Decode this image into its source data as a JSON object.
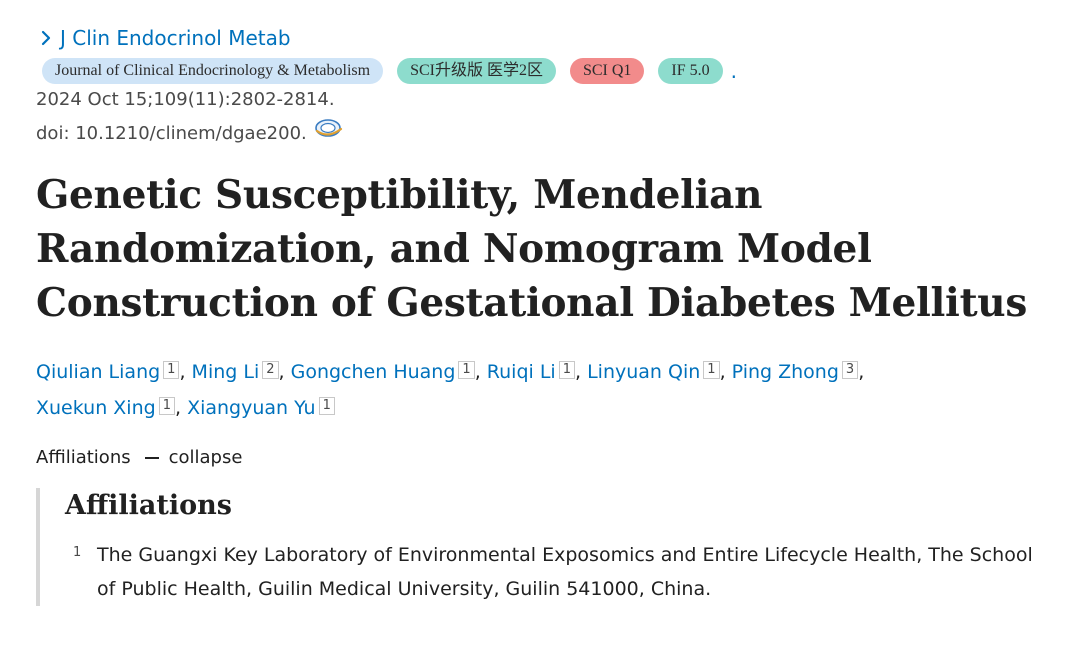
{
  "journal": {
    "abbrev": "J Clin Endocrinol Metab",
    "badges": {
      "full_name": "Journal of Clinical Endocrinology & Metabolism",
      "sci_tier": "SCI升级版 医学2区",
      "sci_q": "SCI Q1",
      "impact_factor": "IF 5.0",
      "trailing": "."
    },
    "citation": "2024 Oct 15;109(11):2802-2814.",
    "doi": "doi: 10.1210/clinem/dgae200."
  },
  "article": {
    "title": "Genetic Susceptibility, Mendelian Randomization, and Nomogram Model Construction of Gestational Diabetes Mellitus"
  },
  "authors": [
    {
      "name": "Qiulian Liang",
      "aff": "1"
    },
    {
      "name": "Ming Li",
      "aff": "2"
    },
    {
      "name": "Gongchen Huang",
      "aff": "1"
    },
    {
      "name": "Ruiqi Li",
      "aff": "1"
    },
    {
      "name": "Linyuan Qin",
      "aff": "1"
    },
    {
      "name": "Ping Zhong",
      "aff": "3"
    },
    {
      "name": "Xuekun Xing",
      "aff": "1"
    },
    {
      "name": "Xiangyuan Yu",
      "aff": "1"
    }
  ],
  "affiliations_toggle": {
    "label": "Affiliations",
    "action": "collapse"
  },
  "affiliations": {
    "heading": "Affiliations",
    "items": [
      {
        "num": "1",
        "text": "The Guangxi Key Laboratory of Environmental Exposomics and Entire Lifecycle Health, The School of Public Health, Guilin Medical University, Guilin 541000, China."
      }
    ]
  },
  "colors": {
    "link": "#0071bc",
    "badge_journal": "#cfe4f7",
    "badge_green": "#8ddccd",
    "badge_red": "#f28b8b"
  },
  "icons": {
    "journal_link": "chevron-right-icon",
    "doi": "doi-link-icon"
  }
}
